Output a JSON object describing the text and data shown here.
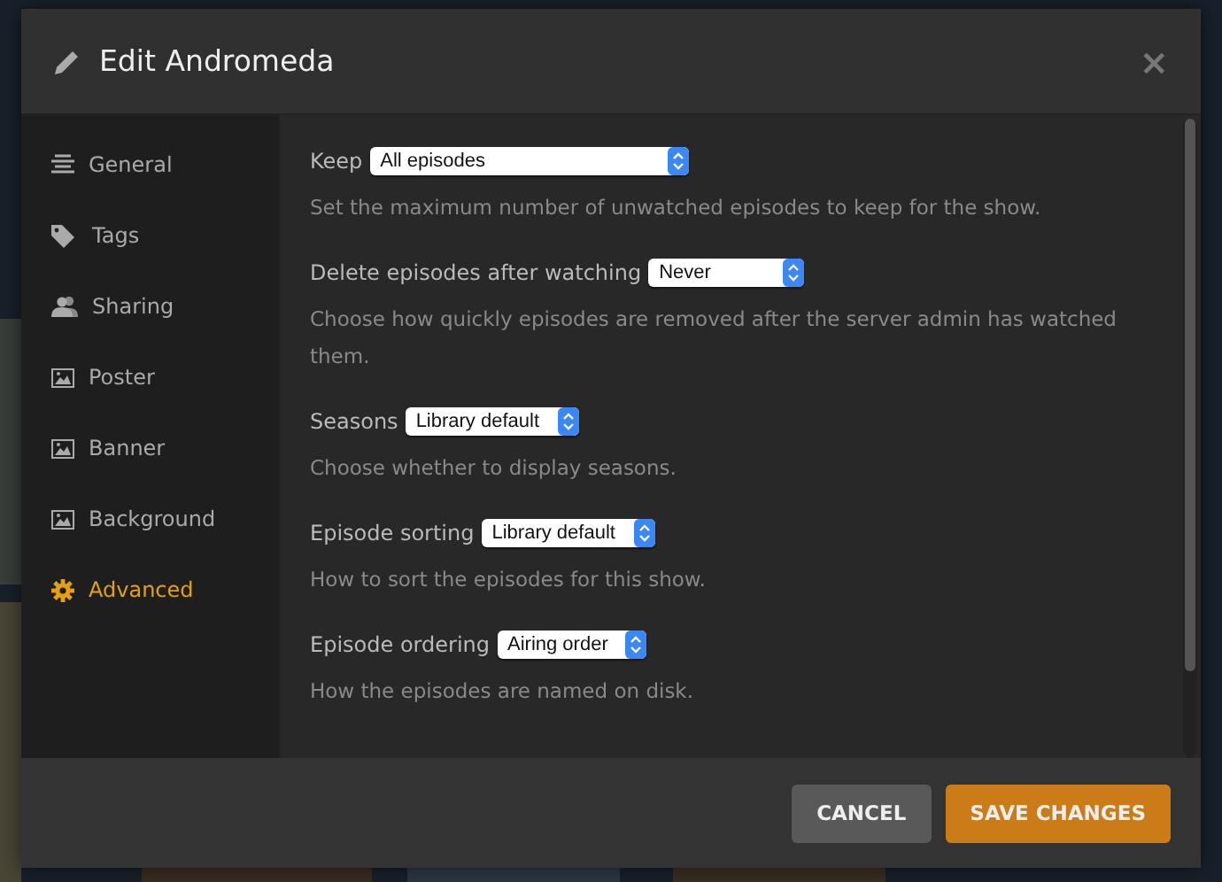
{
  "dialog": {
    "title": "Edit Andromeda",
    "close": "×"
  },
  "sidebar": {
    "items": [
      {
        "label": "General",
        "selected": false
      },
      {
        "label": "Tags",
        "selected": false
      },
      {
        "label": "Sharing",
        "selected": false
      },
      {
        "label": "Poster",
        "selected": false
      },
      {
        "label": "Banner",
        "selected": false
      },
      {
        "label": "Background",
        "selected": false
      },
      {
        "label": "Advanced",
        "selected": true
      }
    ]
  },
  "settings": [
    {
      "label": "Keep",
      "value": "All episodes",
      "description": "Set the maximum number of unwatched episodes to keep for the show."
    },
    {
      "label": "Delete episodes after watching",
      "value": "Never",
      "description": "Choose how quickly episodes are removed after the server admin has watched them."
    },
    {
      "label": "Seasons",
      "value": "Library default",
      "description": "Choose whether to display seasons."
    },
    {
      "label": "Episode sorting",
      "value": "Library default",
      "description": "How to sort the episodes for this show."
    },
    {
      "label": "Episode ordering",
      "value": "Airing order",
      "description": "How the episodes are named on disk."
    }
  ],
  "buttons": [
    {
      "label": "CANCEL",
      "kind": "secondary"
    },
    {
      "label": "SAVE CHANGES",
      "kind": "primary"
    }
  ]
}
